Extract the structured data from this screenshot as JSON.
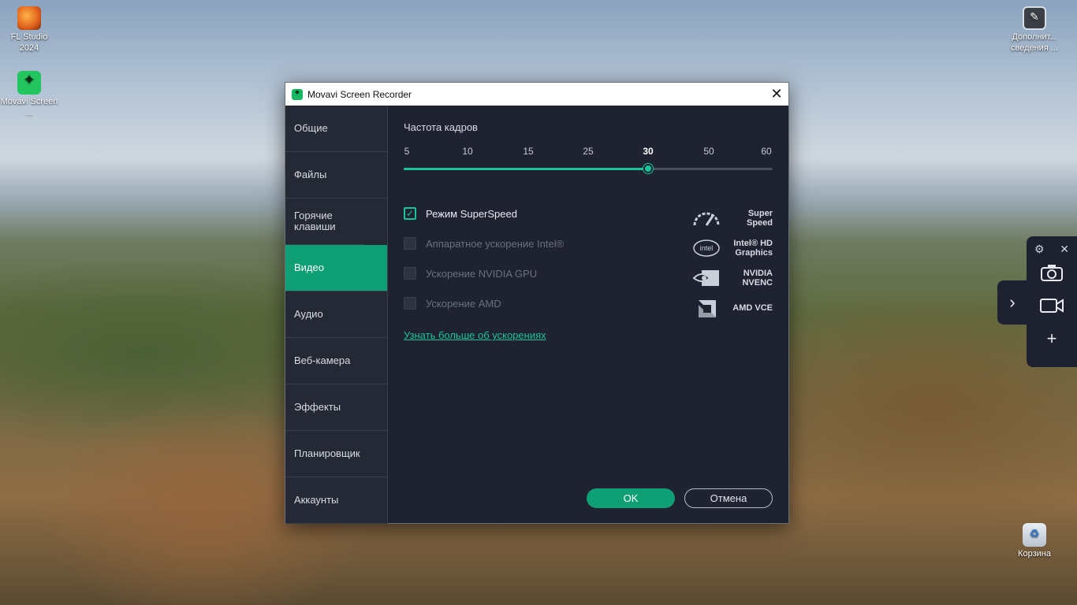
{
  "desktop": {
    "icons": [
      {
        "label": "FL Studio 2024",
        "icon": "fl-studio-icon"
      },
      {
        "label": "Movavi Screen ...",
        "icon": "movavi-icon"
      },
      {
        "label": "Дополнит... сведения ...",
        "icon": "info-icon"
      },
      {
        "label": "Корзина",
        "icon": "recycle-bin-icon"
      }
    ]
  },
  "window": {
    "title": "Movavi Screen Recorder",
    "close_glyph": "✕"
  },
  "sidebar": {
    "items": [
      {
        "label": "Общие"
      },
      {
        "label": "Файлы"
      },
      {
        "label": "Горячие клавиши"
      },
      {
        "label": "Видео",
        "active": true
      },
      {
        "label": "Аудио"
      },
      {
        "label": "Веб-камера"
      },
      {
        "label": "Эффекты"
      },
      {
        "label": "Планировщик"
      },
      {
        "label": "Аккаунты"
      }
    ]
  },
  "video": {
    "fps_title": "Частота кадров",
    "fps_ticks": [
      "5",
      "10",
      "15",
      "25",
      "30",
      "50",
      "60"
    ],
    "fps_selected": "30",
    "options": [
      {
        "label": "Режим SuperSpeed",
        "checked": true,
        "enabled": true
      },
      {
        "label": "Аппаратное ускорение Intel®",
        "checked": false,
        "enabled": false
      },
      {
        "label": "Ускорение NVIDIA GPU",
        "checked": false,
        "enabled": false
      },
      {
        "label": "Ускорение AMD",
        "checked": false,
        "enabled": false
      }
    ],
    "logos": [
      {
        "text": "Super Speed",
        "icon": "speedometer-icon"
      },
      {
        "text": "Intel® HD Graphics",
        "icon": "intel-icon"
      },
      {
        "text": "NVIDIA NVENC",
        "icon": "nvidia-icon"
      },
      {
        "text": "AMD VCE",
        "icon": "amd-icon"
      }
    ],
    "learn_more": "Узнать больше об ускорениях"
  },
  "buttons": {
    "ok": "OK",
    "cancel": "Отмена"
  },
  "colors": {
    "accent": "#0e9f74",
    "accent_light": "#19c39b",
    "panel": "#1f2230"
  }
}
